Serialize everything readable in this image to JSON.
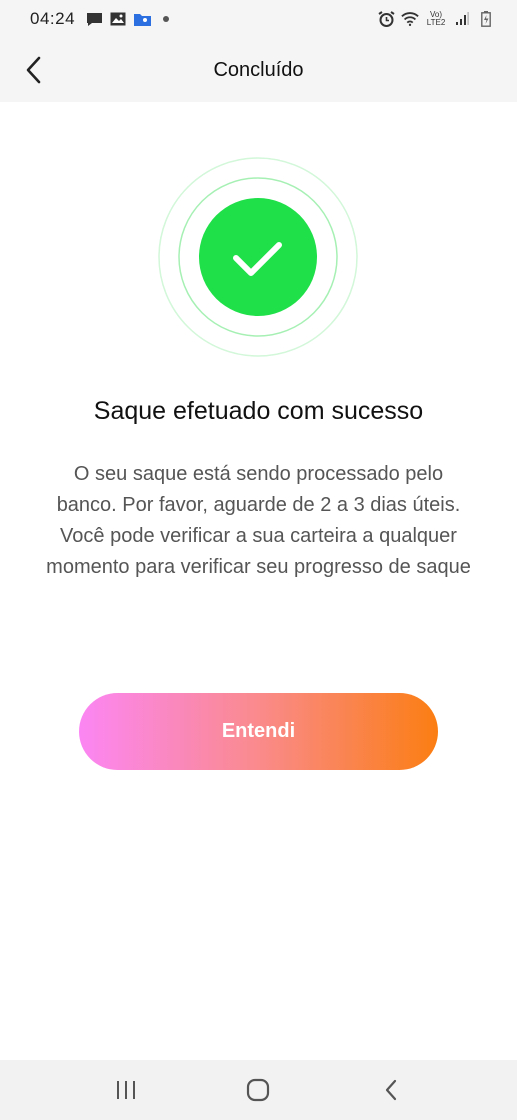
{
  "status_bar": {
    "time": "04:24",
    "left_icons": [
      "message-icon",
      "image-icon",
      "folder-icon",
      "dot-icon"
    ],
    "right_icons": [
      "alarm-icon",
      "wifi-icon",
      "lte-icon",
      "signal-icon",
      "battery-icon"
    ],
    "lte_top": "Vo)",
    "lte_bottom": "LTE2"
  },
  "app_bar": {
    "title": "Concluído",
    "back_icon": "chevron-left-icon"
  },
  "success": {
    "icon": "checkmark-icon",
    "color": "#1fe049",
    "ring_color": "#a6f0b4"
  },
  "main": {
    "headline": "Saque efetuado com sucesso",
    "message_lines": [
      "O seu saque está sendo processado pelo",
      "banco. Por favor, aguarde de 2 a 3 dias úteis.",
      "Você pode verificar a sua carteira a qualquer",
      "momento para verificar seu progresso de saque"
    ],
    "button_label": "Entendi",
    "button_gradient": [
      "#fb86f4",
      "#fb7e12"
    ]
  },
  "nav_bar": {
    "items": [
      "recents-icon",
      "home-icon",
      "back-icon"
    ]
  }
}
